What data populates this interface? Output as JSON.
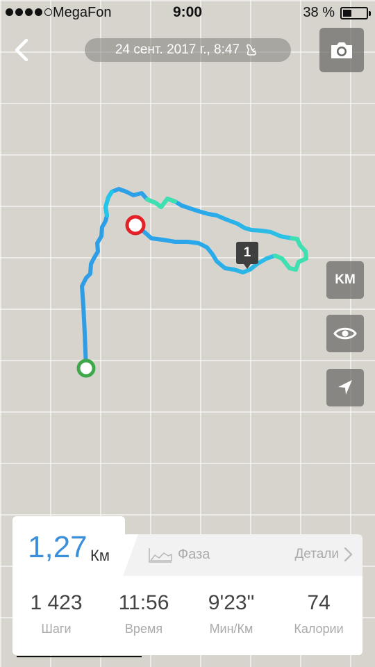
{
  "status_bar": {
    "carrier": "MegaFon",
    "time": "9:00",
    "battery": "38 %",
    "battery_level": 0.38,
    "signal_bars_filled": 4,
    "signal_bars_total": 5
  },
  "header": {
    "date": "24 сент. 2017 г., 8:47",
    "activity_icon": "footprints-icon"
  },
  "map_controls": {
    "units_label": "KM",
    "view_icon": "eye-icon",
    "locate_icon": "navigation-arrow-icon",
    "camera_icon": "camera-icon",
    "back_icon": "chevron-left-icon"
  },
  "map": {
    "split_marker": "1",
    "start_color": "#3ea84a",
    "finish_color": "#e32228",
    "route_colors": [
      "#2f9de6",
      "#22c6ea",
      "#3ee0b0"
    ]
  },
  "summary": {
    "distance": "1,27",
    "distance_unit": "Км",
    "phase_label": "Фаза",
    "details_label": "Детали",
    "accent_color": "#3b8fd9"
  },
  "stats": [
    {
      "value": "1 423",
      "label": "Шаги"
    },
    {
      "value": "11:56",
      "label": "Время"
    },
    {
      "value": "9'23\"",
      "label": "Мин/Км"
    },
    {
      "value": "74",
      "label": "Калории"
    }
  ]
}
